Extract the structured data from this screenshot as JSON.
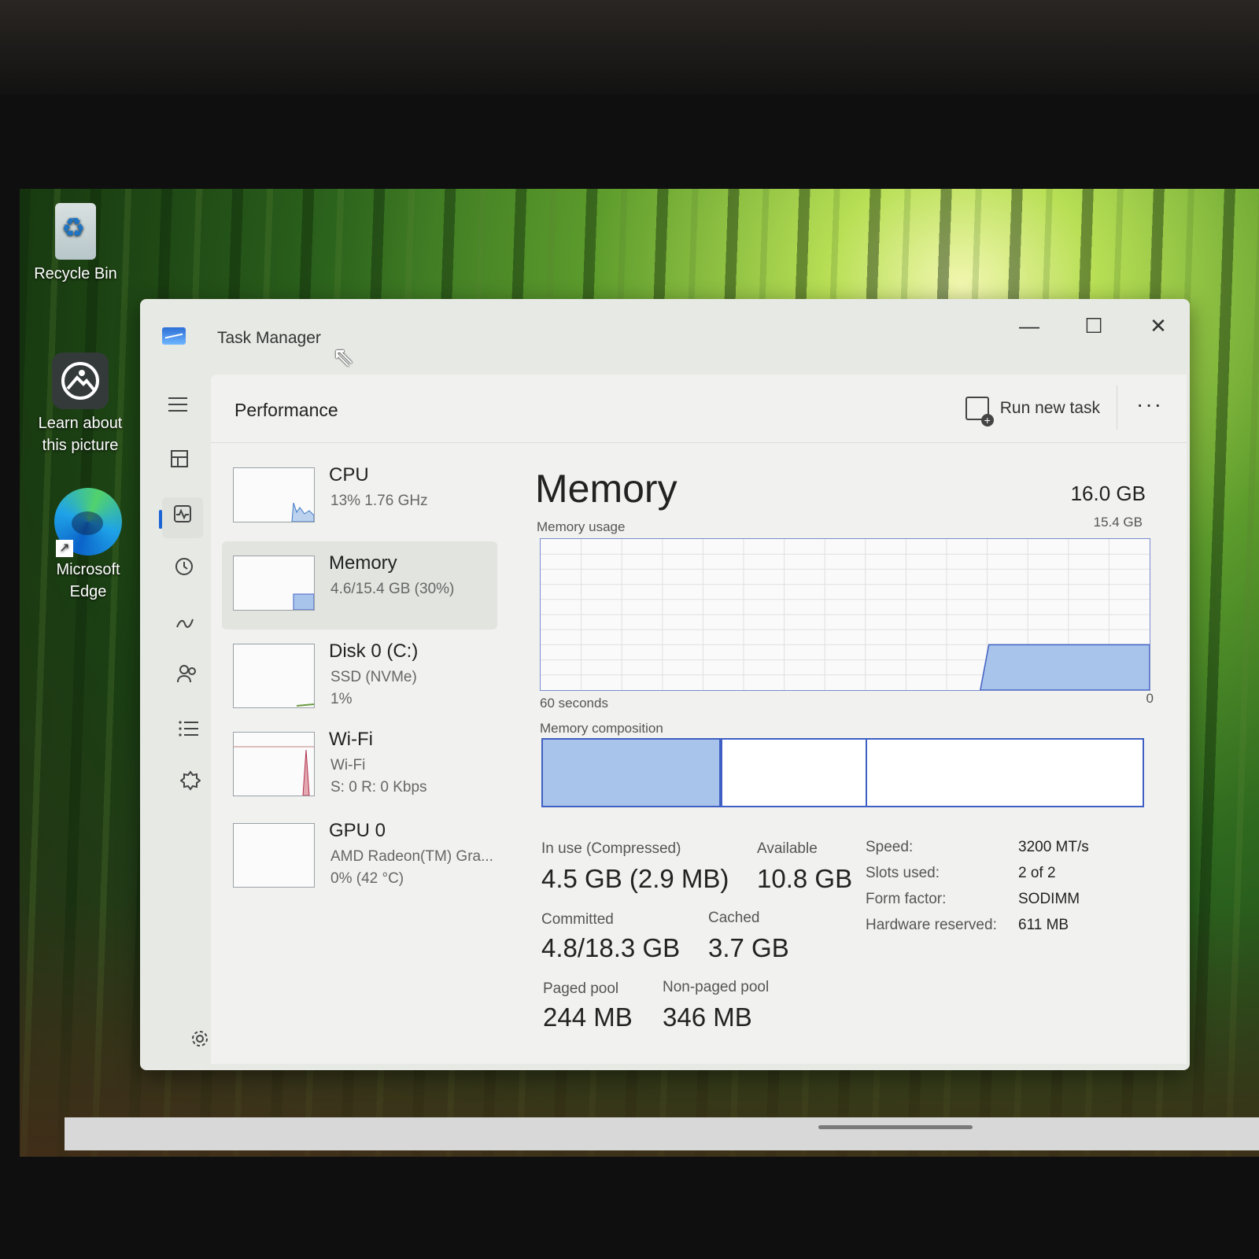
{
  "desktop": {
    "icons": [
      {
        "label": "Recycle Bin"
      },
      {
        "label": "Learn about this picture"
      },
      {
        "label": "Microsoft Edge"
      }
    ]
  },
  "window": {
    "title": "Task Manager",
    "controls": {
      "minimize": "—",
      "maximize": "☐",
      "close": "✕"
    }
  },
  "header": {
    "page_title": "Performance",
    "run_task_label": "Run new task",
    "more_label": "···"
  },
  "nav": [
    {
      "icon": "hamburger-icon"
    },
    {
      "icon": "processes-icon"
    },
    {
      "icon": "performance-icon",
      "active": true
    },
    {
      "icon": "app-history-icon"
    },
    {
      "icon": "startup-apps-icon"
    },
    {
      "icon": "users-icon"
    },
    {
      "icon": "details-icon"
    },
    {
      "icon": "services-icon"
    },
    {
      "icon": "settings-icon"
    }
  ],
  "perf_items": [
    {
      "name": "CPU",
      "line1": "13%  1.76 GHz",
      "line2": ""
    },
    {
      "name": "Memory",
      "line1": "4.6/15.4 GB (30%)",
      "line2": "",
      "selected": true
    },
    {
      "name": "Disk 0 (C:)",
      "line1": "SSD (NVMe)",
      "line2": "1%"
    },
    {
      "name": "Wi-Fi",
      "line1": "Wi-Fi",
      "line2": "S: 0  R: 0 Kbps"
    },
    {
      "name": "GPU 0",
      "line1": "AMD Radeon(TM) Gra...",
      "line2": "0%  (42 °C)"
    }
  ],
  "memory": {
    "title": "Memory",
    "total": "16.0 GB",
    "usage_label": "Memory usage",
    "usage_max": "15.4 GB",
    "time_span": "60 seconds",
    "zero": "0",
    "composition_label": "Memory composition",
    "composition": {
      "in_use_fraction": 0.295,
      "modified_fraction": 0.005,
      "standby_fraction": 0.24,
      "free_fraction": 0.46
    },
    "usage_fraction": 0.3,
    "stats": {
      "in_use_label": "In use (Compressed)",
      "in_use_value": "4.5 GB (2.9 MB)",
      "available_label": "Available",
      "available_value": "10.8 GB",
      "committed_label": "Committed",
      "committed_value": "4.8/18.3 GB",
      "cached_label": "Cached",
      "cached_value": "3.7 GB",
      "paged_label": "Paged pool",
      "paged_value": "244 MB",
      "nonpaged_label": "Non-paged pool",
      "nonpaged_value": "346 MB"
    },
    "specs": {
      "speed_label": "Speed:",
      "speed_value": "3200 MT/s",
      "slots_label": "Slots used:",
      "slots_value": "2 of 2",
      "form_label": "Form factor:",
      "form_value": "SODIMM",
      "hw_label": "Hardware reserved:",
      "hw_value": "611 MB"
    }
  },
  "colors": {
    "accent": "#1a64d6",
    "memory_fill": "#a9c4ea",
    "memory_line": "#3f5fc4"
  }
}
